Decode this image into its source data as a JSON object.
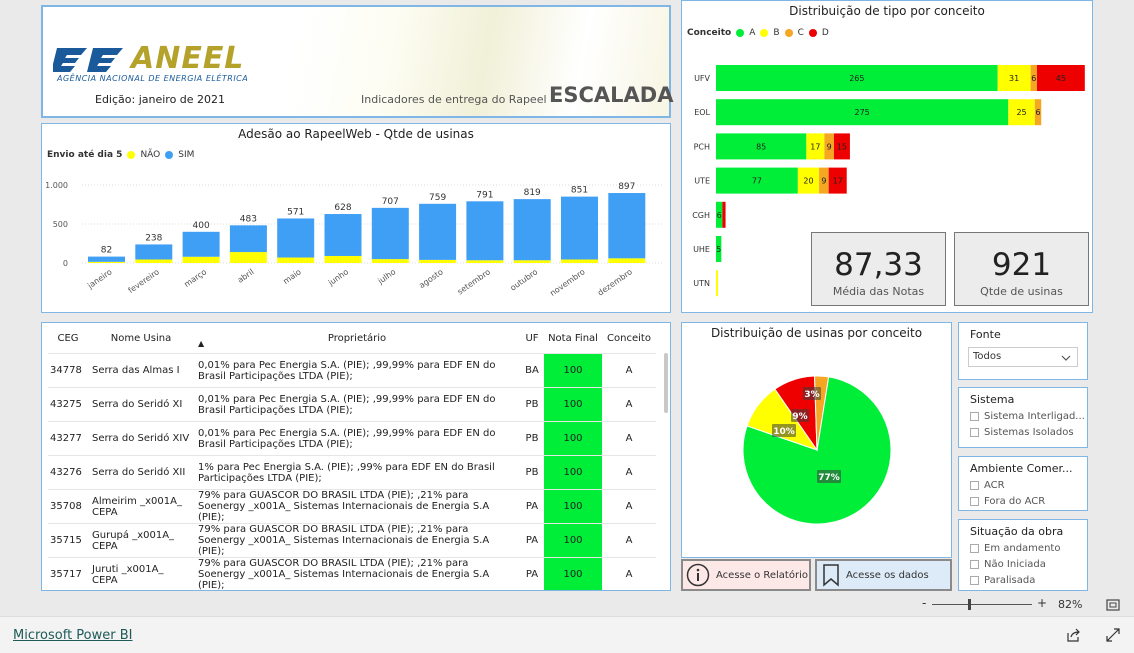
{
  "header": {
    "logo_text": "ANEEL",
    "logo_sub": "AGÊNCIA NACIONAL DE ENERGIA ELÉTRICA",
    "edicao": "Edição: janeiro de 2021",
    "subtitle": "Indicadores de entrega do Rapeel",
    "escalada": "ESCALADA"
  },
  "adesao": {
    "title": "Adesão ao RapeelWeb - Qtde de usinas",
    "legend_title": "Envio até dia 5",
    "legend_nao": "NÃO",
    "legend_sim": "SIM"
  },
  "chart_data": [
    {
      "type": "bar",
      "title": "Adesão ao RapeelWeb - Qtde de usinas",
      "categories": [
        "janeiro",
        "fevereiro",
        "março",
        "abril",
        "maio",
        "junho",
        "julho",
        "agosto",
        "setembro",
        "outubro",
        "novembro",
        "dezembro"
      ],
      "series": [
        {
          "name": "NÃO",
          "color": "#ffff00",
          "values": [
            15,
            45,
            80,
            140,
            70,
            90,
            50,
            40,
            35,
            35,
            45,
            60
          ]
        },
        {
          "name": "SIM",
          "color": "#3f9ff5",
          "values": [
            67,
            193,
            320,
            343,
            501,
            538,
            657,
            719,
            756,
            784,
            806,
            837
          ]
        }
      ],
      "totals": [
        82,
        238,
        400,
        483,
        571,
        628,
        707,
        759,
        791,
        819,
        851,
        897
      ],
      "yticks": [
        "0",
        "500",
        "1.000"
      ],
      "ylim": [
        0,
        1000
      ],
      "stacked": true
    },
    {
      "type": "bar",
      "orientation": "horizontal",
      "title": "Distribuição de tipo por conceito",
      "legend_title": "Conceito",
      "categories": [
        "UFV",
        "EOL",
        "PCH",
        "UTE",
        "CGH",
        "UHE",
        "UTN"
      ],
      "series": [
        {
          "name": "A",
          "color": "#00ee38",
          "values": [
            265,
            275,
            85,
            77,
            6,
            5,
            0
          ]
        },
        {
          "name": "B",
          "color": "#ffff00",
          "values": [
            31,
            25,
            17,
            20,
            0,
            0,
            1
          ]
        },
        {
          "name": "C",
          "color": "#f5a623",
          "values": [
            6,
            6,
            9,
            9,
            0,
            0,
            0
          ]
        },
        {
          "name": "D",
          "color": "#ee0000",
          "values": [
            45,
            0,
            15,
            17,
            3,
            0,
            0
          ]
        }
      ],
      "labels": [
        [
          "265",
          "31",
          "6",
          "45"
        ],
        [
          "275",
          "25",
          "6",
          ""
        ],
        [
          "85",
          "17",
          "9",
          "15"
        ],
        [
          "77",
          "20",
          "9",
          "17"
        ],
        [
          "6",
          "",
          "",
          ""
        ],
        [
          "5",
          "",
          "",
          ""
        ],
        [
          "",
          "",
          "",
          ""
        ]
      ],
      "stacked": true
    },
    {
      "type": "pie",
      "title": "Distribuição de usinas por conceito",
      "slices": [
        {
          "name": "A",
          "value": 77,
          "color": "#00ee38",
          "label": "77%"
        },
        {
          "name": "B",
          "value": 10,
          "color": "#ffff00",
          "label": "10%"
        },
        {
          "name": "D",
          "value": 9,
          "color": "#ee0000",
          "label": "9%"
        },
        {
          "name": "C",
          "value": 3,
          "color": "#f5a623",
          "label": "3%"
        }
      ]
    }
  ],
  "kpi": {
    "media_value": "87,33",
    "media_label": "Média das Notas",
    "qtde_value": "921",
    "qtde_label": "Qtde de usinas"
  },
  "table": {
    "headers": [
      "CEG",
      "Nome Usina",
      "Proprietário",
      "UF",
      "Nota Final",
      "Conceito"
    ],
    "rows": [
      [
        "34778",
        "Serra das Almas I",
        "0,01% para Pec Energia S.A. (PIE); ,99,99% para EDF EN do Brasil Participações LTDA (PIE);",
        "BA",
        "100",
        "A"
      ],
      [
        "43275",
        "Serra do Seridó XI",
        "0,01% para Pec Energia S.A. (PIE); ,99,99% para EDF EN do Brasil Participações LTDA (PIE);",
        "PB",
        "100",
        "A"
      ],
      [
        "43277",
        "Serra do Seridó XIV",
        "0,01% para Pec Energia S.A. (PIE); ,99,99% para EDF EN do Brasil Participações LTDA (PIE);",
        "PB",
        "100",
        "A"
      ],
      [
        "43276",
        "Serra do Seridó XII",
        "1% para Pec Energia S.A. (PIE); ,99% para EDF EN do Brasil Participações LTDA (PIE);",
        "PB",
        "100",
        "A"
      ],
      [
        "35708",
        "Almeirim _x001A_ CEPA",
        "79% para GUASCOR DO BRASIL LTDA (PIE); ,21% para Soenergy _x001A_ Sistemas Internacionais de Energia S.A (PIE);",
        "PA",
        "100",
        "A"
      ],
      [
        "35715",
        "Gurupá _x001A_ CEPA",
        "79% para GUASCOR DO BRASIL LTDA (PIE); ,21% para Soenergy _x001A_ Sistemas Internacionais de Energia S.A (PIE);",
        "PA",
        "100",
        "A"
      ],
      [
        "35717",
        "Juruti _x001A_ CEPA",
        "79% para GUASCOR DO BRASIL LTDA (PIE); ,21% para Soenergy _x001A_ Sistemas Internacionais de Energia S.A (PIE);",
        "PA",
        "100",
        "A"
      ]
    ]
  },
  "slicers": {
    "fonte": {
      "title": "Fonte",
      "selected": "Todos"
    },
    "sistema": {
      "title": "Sistema",
      "options": [
        "Sistema Interligad...",
        "Sistemas Isolados"
      ]
    },
    "ambiente": {
      "title": "Ambiente Comer...",
      "options": [
        "ACR",
        "Fora do ACR"
      ]
    },
    "situacao": {
      "title": "Situação da obra",
      "options": [
        "Em andamento",
        "Não Iniciada",
        "Paralisada"
      ]
    }
  },
  "buttons": {
    "relatorio": "Acesse o Relatório",
    "dados": "Acesse os dados"
  },
  "footer": {
    "brand": "Microsoft Power BI",
    "zoom_minus": "-",
    "zoom_plus": "+",
    "zoom": "82%"
  },
  "colors": {
    "accent": "#7eb6e6",
    "sim": "#3f9ff5",
    "nao": "#ffff00",
    "A": "#00ee38",
    "B": "#ffff00",
    "C": "#f5a623",
    "D": "#ee0000"
  }
}
